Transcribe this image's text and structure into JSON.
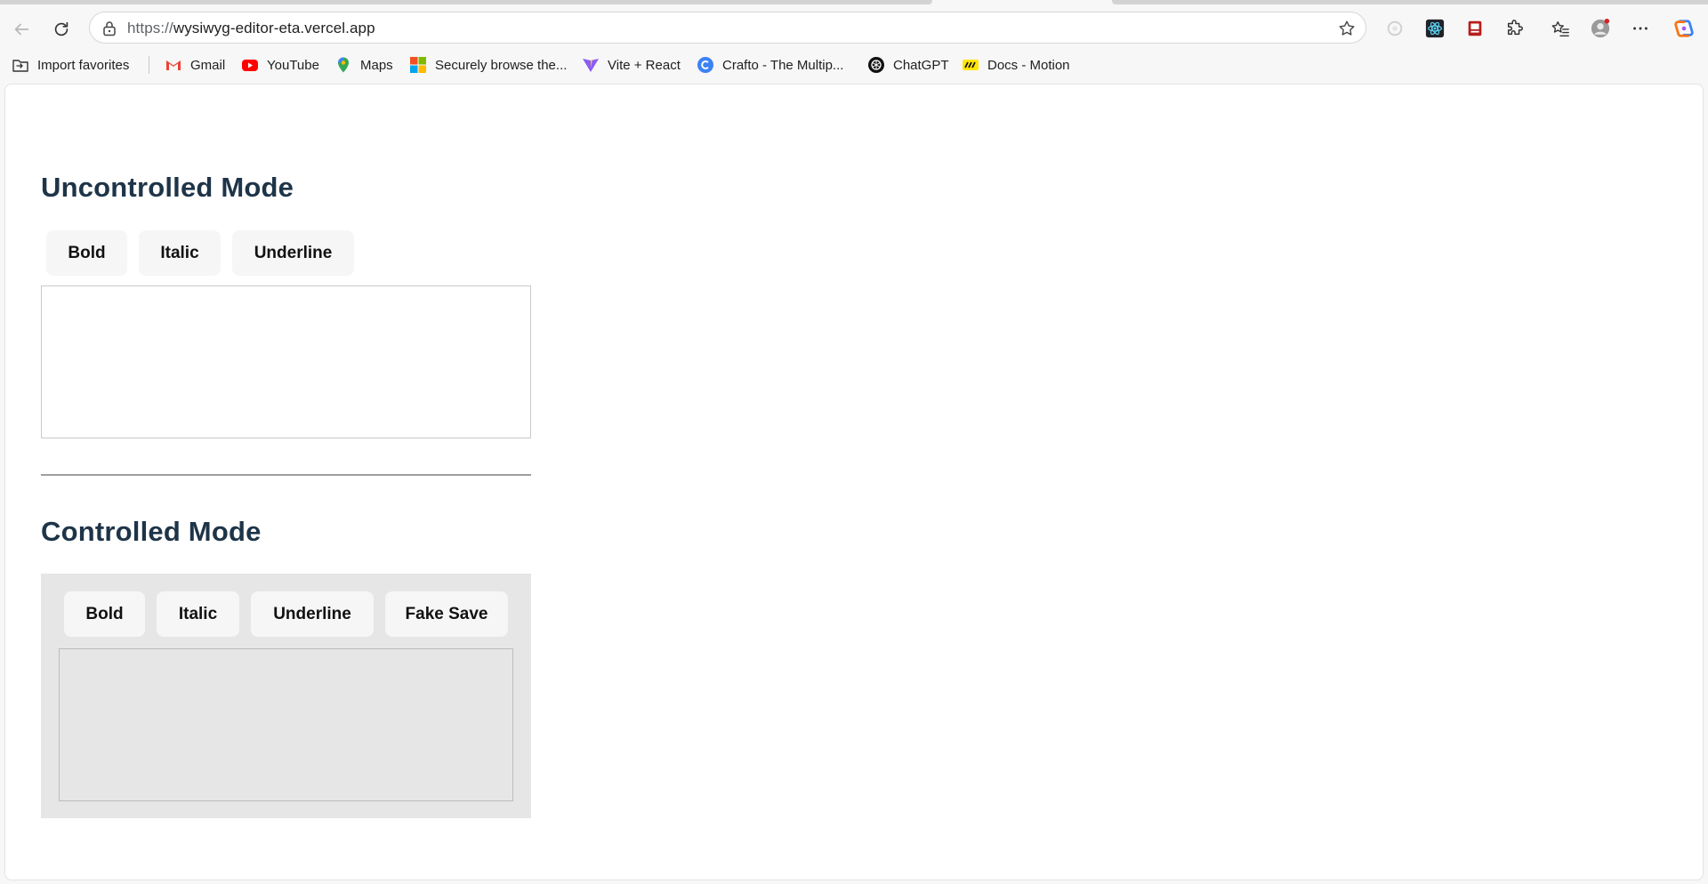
{
  "browser": {
    "url_protocol": "https://",
    "url_host": "wysiwyg-editor-eta.vercel.app",
    "bookmarks": [
      {
        "label": "Import favorites",
        "icon": "import-favorites-icon"
      },
      {
        "label": "Gmail",
        "icon": "gmail-icon"
      },
      {
        "label": "YouTube",
        "icon": "youtube-icon"
      },
      {
        "label": "Maps",
        "icon": "maps-icon"
      },
      {
        "label": "Securely browse the...",
        "icon": "microsoft-icon"
      },
      {
        "label": "Vite + React",
        "icon": "vite-icon"
      },
      {
        "label": "Crafto - The Multip...",
        "icon": "crafto-icon"
      },
      {
        "label": "ChatGPT",
        "icon": "chatgpt-icon"
      },
      {
        "label": "Docs - Motion",
        "icon": "motion-icon"
      }
    ]
  },
  "uncontrolled": {
    "title": "Uncontrolled Mode",
    "buttons": {
      "bold": "Bold",
      "italic": "Italic",
      "underline": "Underline"
    }
  },
  "controlled": {
    "title": "Controlled Mode",
    "buttons": {
      "bold": "Bold",
      "italic": "Italic",
      "underline": "Underline",
      "save": "Fake Save"
    }
  },
  "colors": {
    "heading": "#1e3448",
    "button_bg": "#f6f6f6",
    "controlled_bg": "#e6e6e6"
  }
}
